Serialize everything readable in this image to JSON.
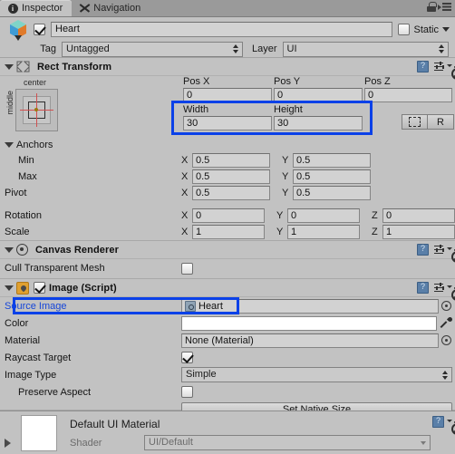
{
  "window": {
    "tabs": [
      {
        "label": "Inspector",
        "icon": "info-icon",
        "active": true
      },
      {
        "label": "Navigation",
        "icon": "navigation-icon",
        "active": false
      }
    ],
    "lock_icon": "lock-icon",
    "menu_icon": "hamburger-menu-icon"
  },
  "gameobject": {
    "icon": "unity-gameobject-cube-icon",
    "enabled": true,
    "name": "Heart",
    "static_label": "Static",
    "static_checked": false,
    "tag_label": "Tag",
    "tag_value": "Untagged",
    "layer_label": "Layer",
    "layer_value": "UI"
  },
  "rect_transform": {
    "title": "Rect Transform",
    "expanded": true,
    "anchor_preset": {
      "horizontal": "center",
      "vertical": "middle"
    },
    "pos_labels": [
      "Pos X",
      "Pos Y",
      "Pos Z"
    ],
    "pos_values": [
      "0",
      "0",
      "0"
    ],
    "size_labels": [
      "Width",
      "Height"
    ],
    "size_values": [
      "30",
      "30"
    ],
    "blueprint_button": "blueprint-mode-icon",
    "raw_button": "R",
    "anchors_label": "Anchors",
    "min_label": "Min",
    "min": {
      "x": "0.5",
      "y": "0.5"
    },
    "max_label": "Max",
    "max": {
      "x": "0.5",
      "y": "0.5"
    },
    "pivot_label": "Pivot",
    "pivot": {
      "x": "0.5",
      "y": "0.5"
    },
    "rotation_label": "Rotation",
    "rotation": {
      "x": "0",
      "y": "0",
      "z": "0"
    },
    "scale_label": "Scale",
    "scale": {
      "x": "1",
      "y": "1",
      "z": "1"
    },
    "axis_x": "X",
    "axis_y": "Y",
    "axis_z": "Z"
  },
  "canvas_renderer": {
    "title": "Canvas Renderer",
    "cull_label": "Cull Transparent Mesh",
    "cull_checked": false
  },
  "image_script": {
    "title": "Image (Script)",
    "enabled": true,
    "source_image_label": "Source Image",
    "source_image_value": "Heart",
    "color_label": "Color",
    "color_value": "#FFFFFF",
    "material_label": "Material",
    "material_value": "None (Material)",
    "raycast_label": "Raycast Target",
    "raycast_checked": true,
    "image_type_label": "Image Type",
    "image_type_value": "Simple",
    "preserve_aspect_label": "Preserve Aspect",
    "preserve_aspect_checked": false,
    "set_native_size_label": "Set Native Size"
  },
  "material_preview": {
    "name": "Default UI Material",
    "shader_label": "Shader",
    "shader_value": "UI/Default"
  },
  "highlights": {
    "accent_color": "#0B41E8",
    "regions": [
      "width-height-fields",
      "source-image-row"
    ]
  }
}
